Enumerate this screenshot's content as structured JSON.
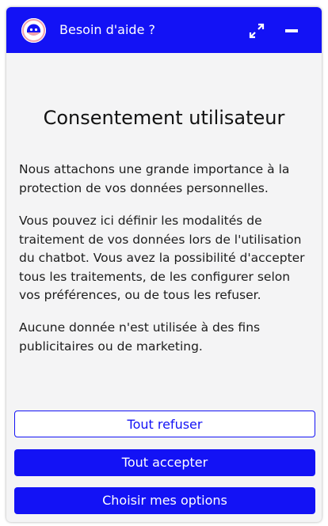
{
  "header": {
    "title": "Besoin d'aide ?",
    "avatar_icon": "chatbot-avatar-icon",
    "expand_icon": "expand-icon",
    "minimize_icon": "minimize-icon",
    "color": "#1312f5"
  },
  "consent": {
    "title": "Consentement utilisateur",
    "paragraphs": [
      "Nous attachons une grande importance à la protection de vos données personnelles.",
      "Vous pouvez ici définir les modalités de traitement de vos données lors de l'utilisation du chatbot. Vous avez la possibilité d'accepter tous les traitements, de les configurer selon vos préférences, ou de tous les refuser.",
      "Aucune donnée n'est utilisée à des fins publicitaires ou de marketing."
    ]
  },
  "buttons": {
    "refuse_label": "Tout refuser",
    "accept_label": "Tout accepter",
    "options_label": "Choisir mes options"
  }
}
